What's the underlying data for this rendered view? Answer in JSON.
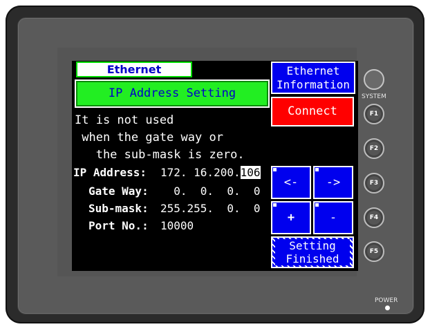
{
  "screen": {
    "tab_title": "Ethernet",
    "page_title": "IP Address Setting",
    "message_lines": [
      "It is not used",
      " when the gate way or",
      "   the sub-mask is zero."
    ],
    "fields": [
      {
        "label": "IP Address:",
        "value_prefix": "172. 16.200.",
        "value_selected": "106"
      },
      {
        "label": "Gate Way:",
        "value_prefix": "  0.  0.  0.  0",
        "value_selected": ""
      },
      {
        "label": "Sub-mask:",
        "value_prefix": "255.255.  0.  0",
        "value_selected": ""
      },
      {
        "label": "Port No.:",
        "value_prefix": "10000",
        "value_selected": ""
      }
    ],
    "buttons": {
      "info_line1": "Ethernet",
      "info_line2": "Information",
      "connect": "Connect",
      "left": "<-",
      "right": "->",
      "plus": "+",
      "minus": "-",
      "finish_line1": "Setting",
      "finish_line2": "Finished"
    }
  },
  "hardware": {
    "system_label": "SYSTEM",
    "keys": [
      "F1",
      "F2",
      "F3",
      "F4",
      "F5"
    ],
    "power_label": "POWER"
  },
  "colors": {
    "lcd_bg": "#000000",
    "button_blue": "#0000ee",
    "connect_red": "#ff0000",
    "title_green": "#22ee22"
  }
}
